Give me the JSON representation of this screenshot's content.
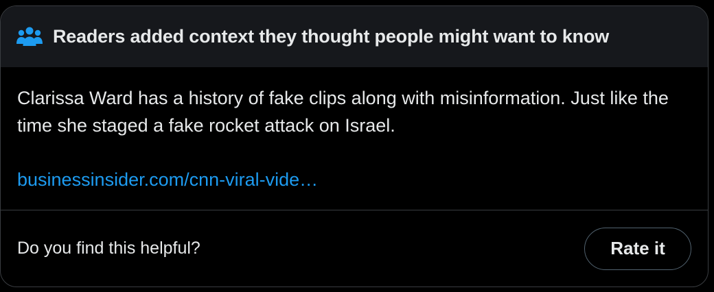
{
  "header": {
    "icon": "people-icon",
    "title": "Readers added context they thought people might want to know"
  },
  "note": {
    "text": "Clarissa Ward has a history of fake clips along with misinformation. Just like the time she staged a fake rocket attack on Israel.",
    "link": "businessinsider.com/cnn-viral-vide…"
  },
  "footer": {
    "question": "Do you find this helpful?",
    "rate_label": "Rate it"
  },
  "colors": {
    "background": "#000000",
    "header_background": "#16181c",
    "text": "#e7e9ea",
    "link": "#1d9bf0",
    "border": "#3a3d41"
  }
}
